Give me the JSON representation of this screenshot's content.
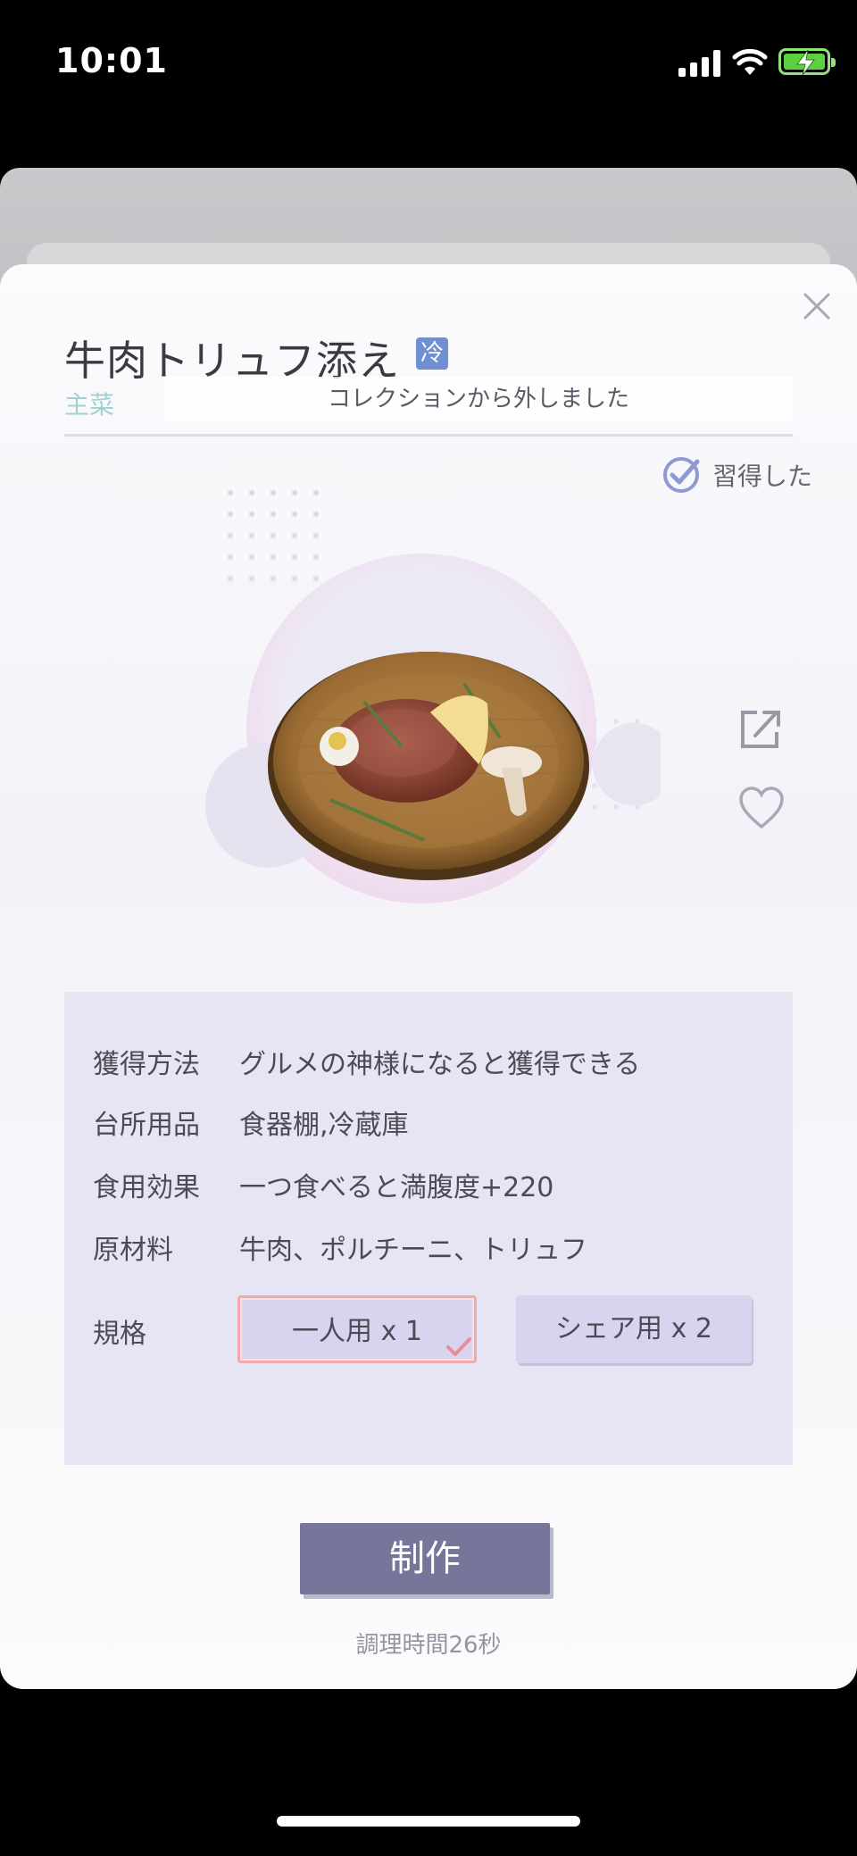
{
  "status_bar": {
    "time": "10:01",
    "signal_icon": "cellular-signal-icon",
    "wifi_icon": "wifi-icon",
    "battery_icon": "battery-charging-icon",
    "battery_color": "#5cd03f"
  },
  "modal": {
    "close_icon": "close-icon",
    "title": "牛肉トリュフ添え",
    "temp_badge": "冷",
    "category": "主菜",
    "toast": "コレクションから外しました",
    "learned_icon": "check-circle-icon",
    "learned_label": "習得した",
    "share_icon": "share-icon",
    "favorite_icon": "heart-icon",
    "dish_image": "beef-truffle-plate-image"
  },
  "info": {
    "rows": [
      {
        "label": "獲得方法",
        "value": "グルメの神様になると獲得できる"
      },
      {
        "label": "台所用品",
        "value": "食器棚,冷蔵庫"
      },
      {
        "label": "食用効果",
        "value": "一つ食べると満腹度+220"
      },
      {
        "label": "原材料",
        "value": "牛肉、ポルチーニ、トリュフ"
      }
    ],
    "size_label": "規格",
    "size_options": [
      {
        "label": "一人用 x 1",
        "selected": true
      },
      {
        "label": "シェア用 x 2",
        "selected": false
      }
    ]
  },
  "action": {
    "make_label": "制作",
    "cook_time": "調理時間26秒"
  },
  "colors": {
    "accent": "#76759a",
    "panel": "#e6e5f3",
    "option": "#d7d4f0",
    "selected_border": "#f1a9b0",
    "category": "#9fd2d0"
  }
}
